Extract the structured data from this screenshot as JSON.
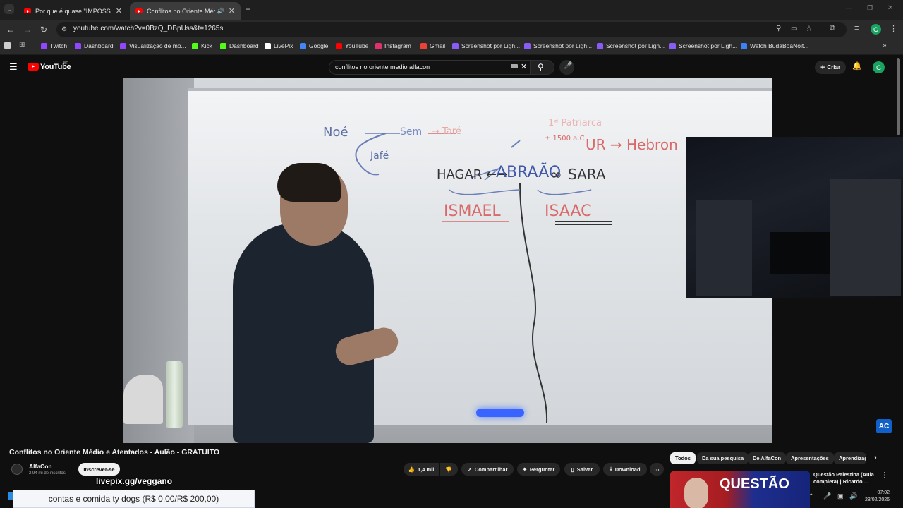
{
  "browser": {
    "tabs": [
      {
        "title": "Por que é quase \"IMPOSSÍVEL\"",
        "active": false
      },
      {
        "title": "Conflitos no Oriente Médio",
        "active": true
      }
    ],
    "url": "youtube.com/watch?v=0BzQ_DBpUss&t=1265s",
    "bookmarks": [
      {
        "label": "Twitch",
        "color": "#9146ff"
      },
      {
        "label": "Dashboard",
        "color": "#9146ff"
      },
      {
        "label": "Visualização de mo...",
        "color": "#9146ff"
      },
      {
        "label": "Kick",
        "color": "#53fc18"
      },
      {
        "label": "Dashboard",
        "color": "#53fc18"
      },
      {
        "label": "LivePix",
        "color": "#ffffff"
      },
      {
        "label": "Google",
        "color": "#4285f4"
      },
      {
        "label": "YouTube",
        "color": "#ff0000"
      },
      {
        "label": "Instagram",
        "color": "#e1306c"
      },
      {
        "label": "Gmail",
        "color": "#ea4335"
      },
      {
        "label": "Screenshot por Ligh...",
        "color": "#8a5cf6"
      },
      {
        "label": "Screenshot por Ligh...",
        "color": "#8a5cf6"
      },
      {
        "label": "Screenshot por Ligh...",
        "color": "#8a5cf6"
      },
      {
        "label": "Screenshot por Ligh...",
        "color": "#8a5cf6"
      },
      {
        "label": "Watch BudaBoaNoit...",
        "color": "#3b82f6"
      }
    ],
    "profile_initial": "G"
  },
  "youtube": {
    "logo_text": "YouTube",
    "country_code": "BR",
    "search_query": "conflitos no oriente medio alfacon",
    "create_label": "Criar",
    "avatar_initial": "G"
  },
  "whiteboard": {
    "noe": "Noé",
    "sem": "Sem",
    "tare": "→ Taré",
    "jafe": "Jafé",
    "top_right": "1ª Patriarca",
    "year": "± 1500 a.C",
    "ur": "UR → Hebron",
    "hagar": "HAGAR ←→",
    "abraao": "ABRAÃO",
    "sara": "SARA",
    "ismael": "ISMAEL",
    "isaac": "ISAAC"
  },
  "video": {
    "title": "Conflitos no Oriente Médio e Atentados - Aulão - GRATUITO",
    "channel": "AlfaCon",
    "subscribers": "2,94 mi de inscritos",
    "subscribe_label": "Inscrever-se",
    "likes": "1,4 mil",
    "share_label": "Compartilhar",
    "ask_label": "Perguntar",
    "save_label": "Salvar",
    "download_label": "Download",
    "brand_logo": "AC"
  },
  "recommendations": {
    "chips": [
      "Todos",
      "Da sua pesquisa",
      "De AlfaCon",
      "Apresentações",
      "Aprendizagem"
    ],
    "first_title": "Questão Palestina (Aula completa) | Ricardo ...",
    "thumb_text": "QUESTÃO"
  },
  "overlay": {
    "livepix_url": "livepix.gg/veggano",
    "goal_text": "contas e comida ty dogs (R$ 0,00/R$ 200,00)",
    "goal_progress": 0
  },
  "taskbar": {
    "time": "07:02",
    "date": "28/02/2026"
  }
}
